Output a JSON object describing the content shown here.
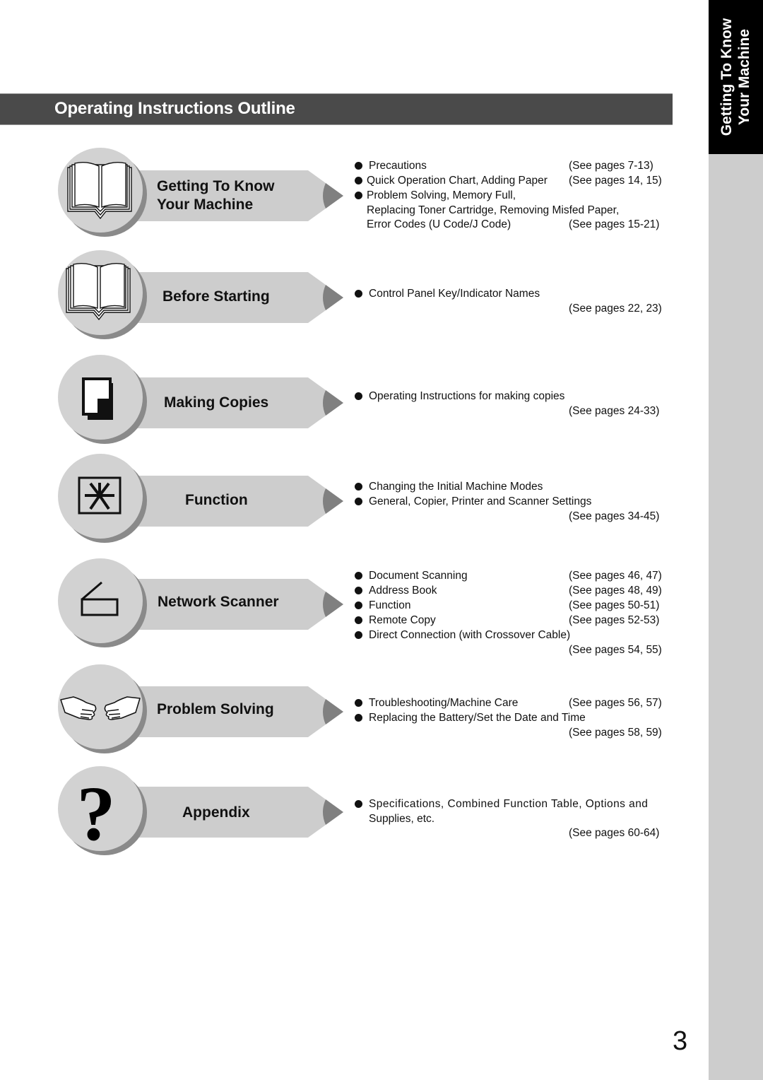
{
  "side_tab": {
    "line1": "Getting To Know",
    "line2": "Your Machine"
  },
  "header": {
    "title": "Operating Instructions Outline"
  },
  "sections": [
    {
      "label_line1": "Getting To Know",
      "label_line2": "Your Machine",
      "icon": "open-book-icon",
      "items": [
        {
          "text": "Precautions",
          "ref": "(See pages 7-13)"
        },
        {
          "text": "Quick Operation Chart, Adding Paper",
          "ref": "(See pages 14, 15)"
        },
        {
          "text": "Problem Solving, Memory Full,",
          "cont": [
            "Replacing Toner Cartridge, Removing Misfed Paper,",
            "Error Codes (U Code/J Code)"
          ],
          "ref": "(See pages 15-21)"
        }
      ]
    },
    {
      "label_line1": "Before Starting",
      "icon": "open-book-icon",
      "items": [
        {
          "text": "Control Panel Key/Indicator Names"
        }
      ],
      "ref": "(See pages 22, 23)"
    },
    {
      "label_line1": "Making Copies",
      "icon": "copy-document-icon",
      "items": [
        {
          "text": "Operating Instructions for making copies"
        }
      ],
      "ref": "(See pages 24-33)"
    },
    {
      "label_line1": "Function",
      "icon": "function-asterisk-icon",
      "items": [
        {
          "text": "Changing the Initial Machine Modes"
        },
        {
          "text": "General, Copier, Printer and Scanner Settings"
        }
      ],
      "ref": "(See pages 34-45)"
    },
    {
      "label_line1": "Network Scanner",
      "icon": "scanner-icon",
      "items": [
        {
          "text": "Document Scanning",
          "ref": "(See pages 46, 47)"
        },
        {
          "text": "Address Book",
          "ref": "(See pages 48, 49)"
        },
        {
          "text": "Function",
          "ref": "(See pages 50-51)"
        },
        {
          "text": "Remote Copy",
          "ref": "(See pages 52-53)"
        },
        {
          "text": "Direct Connection (with Crossover Cable)"
        }
      ],
      "ref": "(See pages 54, 55)"
    },
    {
      "label_line1": "Problem Solving",
      "icon": "handshake-icon",
      "items": [
        {
          "text": "Troubleshooting/Machine Care",
          "ref": "(See pages 56, 57)"
        },
        {
          "text": "Replacing the Battery/Set the Date and Time"
        }
      ],
      "ref": "(See pages 58, 59)"
    },
    {
      "label_line1": "Appendix",
      "icon": "question-mark-icon",
      "items": [
        {
          "text": "Specifications, Combined Function Table, Options and",
          "cont": [
            "Supplies, etc."
          ]
        }
      ],
      "ref": "(See pages 60-64)"
    }
  ],
  "page_number": "3",
  "colors": {
    "title_bar": "#4a4a4a",
    "banner": "#cdcdcd",
    "badge": "#d2d2d2",
    "shadow": "#8a8a8a",
    "side_tab": "#000000",
    "side_strip": "#cdcdcd"
  }
}
